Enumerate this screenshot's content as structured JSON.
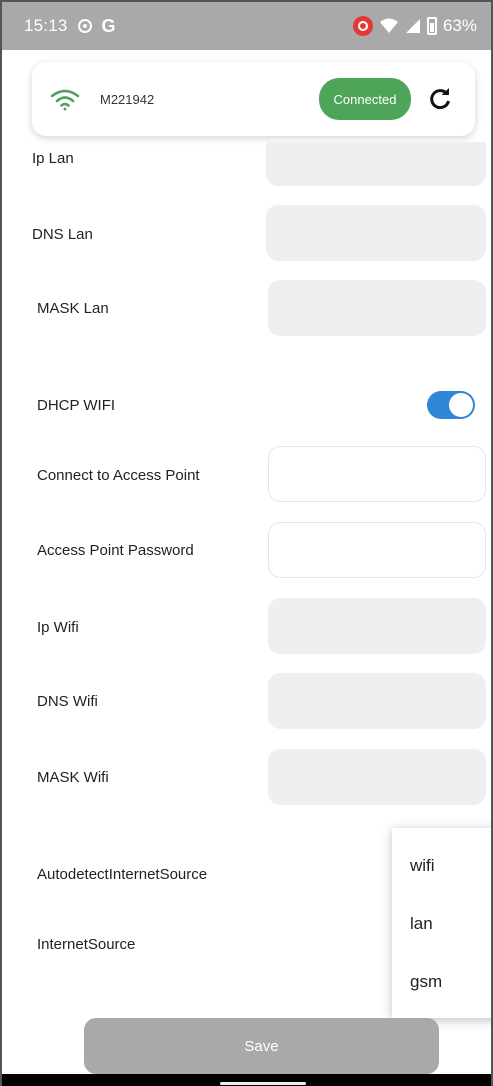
{
  "status_bar": {
    "time": "15:13",
    "g_label": "G",
    "battery": "63%"
  },
  "header": {
    "device_name": "M221942",
    "status": "Connected",
    "accent": "#4ea55a",
    "icons": [
      "wifi-icon",
      "refresh-icon"
    ]
  },
  "form": {
    "ip_lan_label": "Ip Lan",
    "dns_lan_label": "DNS Lan",
    "mask_lan_label": "MASK Lan",
    "dhcp_wifi_label": "DHCP WIFI",
    "dhcp_wifi_on": true,
    "access_point_label": "Connect to Access Point",
    "access_point_password_label": "Access Point Password",
    "ip_wifi_label": "Ip Wifi",
    "dns_wifi_label": "DNS Wifi",
    "mask_wifi_label": "MASK Wifi",
    "autodetect_label": "AutodetectInternetSource",
    "internet_source_label": "InternetSource"
  },
  "dropdown": {
    "options": [
      "wifi",
      "lan",
      "gsm"
    ]
  },
  "save_label": "Save",
  "colors": {
    "toggle": "#2f86d6",
    "status_bar": "#a9a9a9",
    "save_button": "#a9a9a9"
  }
}
